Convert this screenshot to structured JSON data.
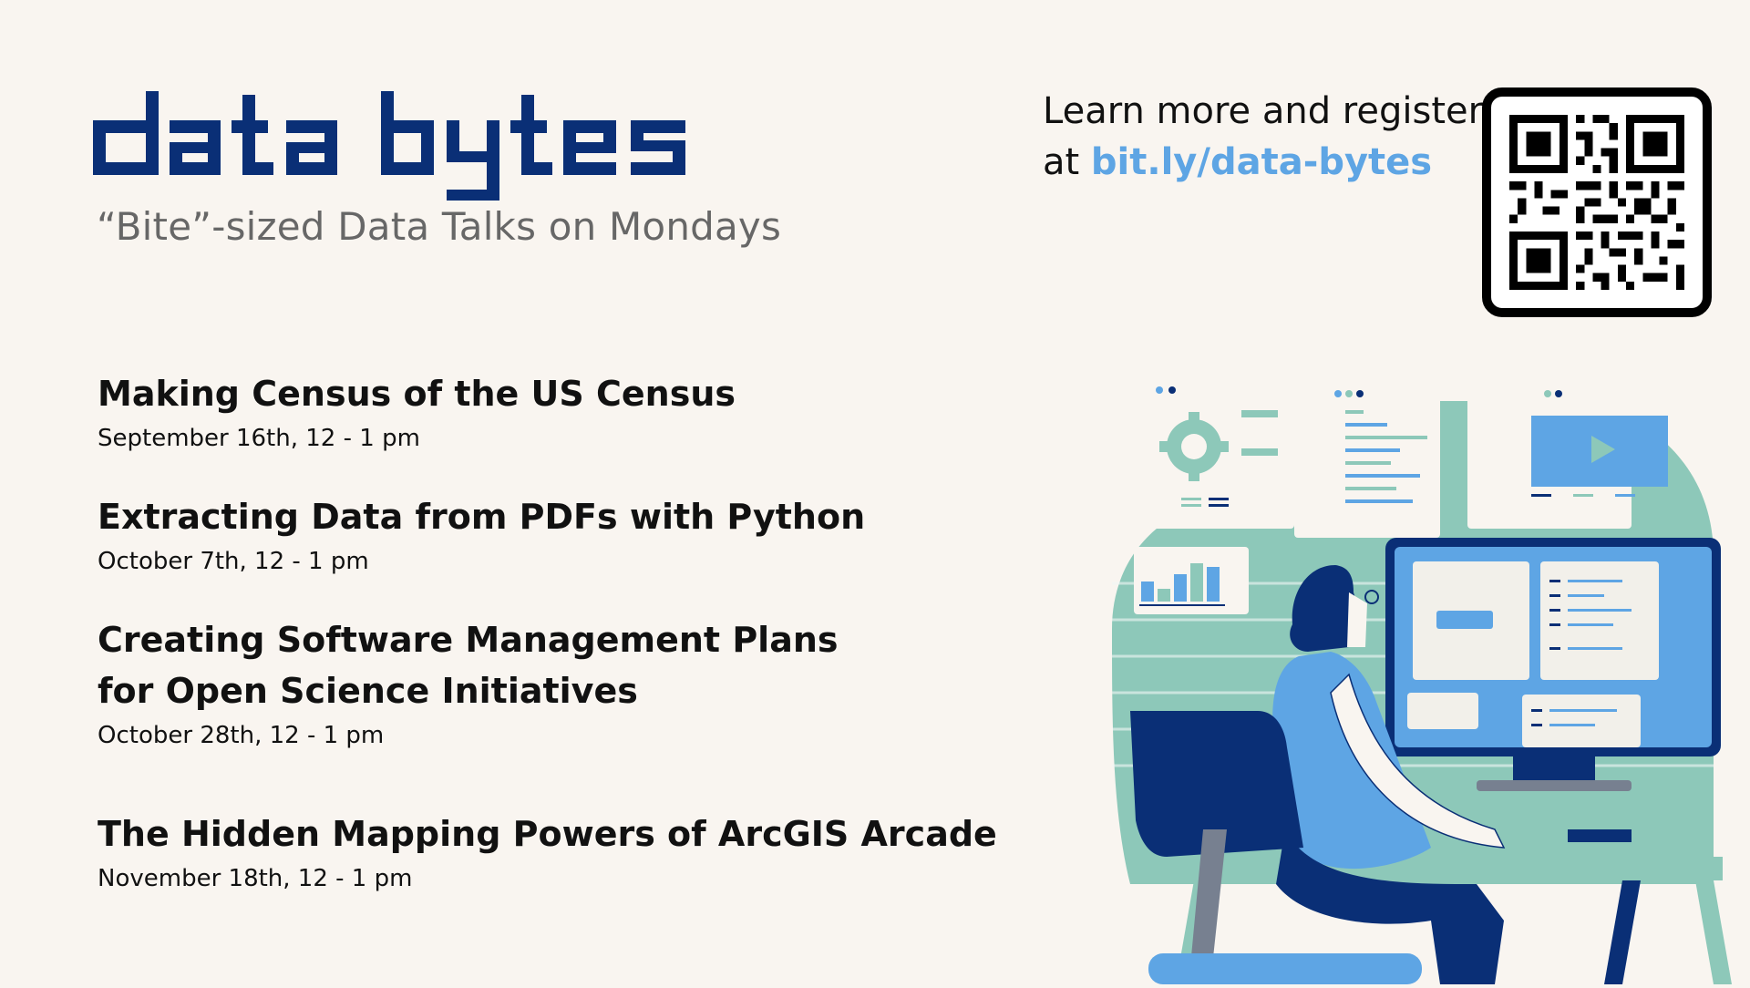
{
  "header": {
    "title": "data bytes",
    "subtitle": "“Bite”-sized Data Talks on Mondays"
  },
  "register": {
    "line1": "Learn more and register",
    "at": "at",
    "link": "bit.ly/data-bytes"
  },
  "talks": [
    {
      "title_lines": [
        "Making Census of the US Census"
      ],
      "date": "September 16th, 12 - 1 pm"
    },
    {
      "title_lines": [
        "Extracting Data from PDFs with Python"
      ],
      "date": "October 7th, 12 - 1 pm"
    },
    {
      "title_lines": [
        "Creating Software Management Plans",
        "for Open Science Initiatives"
      ],
      "date": "October 28th, 12 - 1 pm"
    },
    {
      "title_lines": [
        "The Hidden Mapping Powers of ArcGIS Arcade"
      ],
      "date": "November 18th, 12 - 1 pm"
    }
  ],
  "colors": {
    "navy": "#0a2f76",
    "accent_blue": "#5ea5e4",
    "teal": "#8dc8b9",
    "background": "#f9f5f0"
  },
  "icons": [
    "qr-code-icon",
    "gear-icon",
    "play-icon",
    "bar-chart-icon",
    "person-at-computer-illustration"
  ]
}
